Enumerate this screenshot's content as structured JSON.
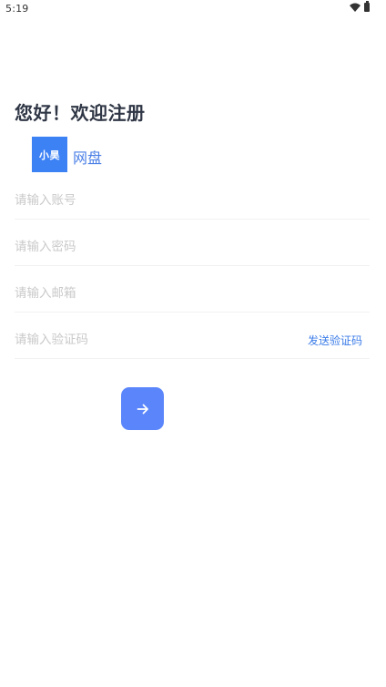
{
  "status_bar": {
    "time": "5:19",
    "icons": [
      "wifi-icon",
      "battery-icon"
    ]
  },
  "header": {
    "title": "您好！欢迎注册",
    "logo_text": "小昊",
    "brand_name": "网盘"
  },
  "form": {
    "account_placeholder": "请输入账号",
    "password_placeholder": "请输入密码",
    "email_placeholder": "请输入邮箱",
    "code_placeholder": "请输入验证码",
    "send_code_label": "发送验证码",
    "submit_icon": "arrow-right-icon"
  },
  "colors": {
    "accent": "#5b86fb",
    "logo": "#3d82f5",
    "link": "#3b7ce8",
    "title": "#2f3645"
  }
}
